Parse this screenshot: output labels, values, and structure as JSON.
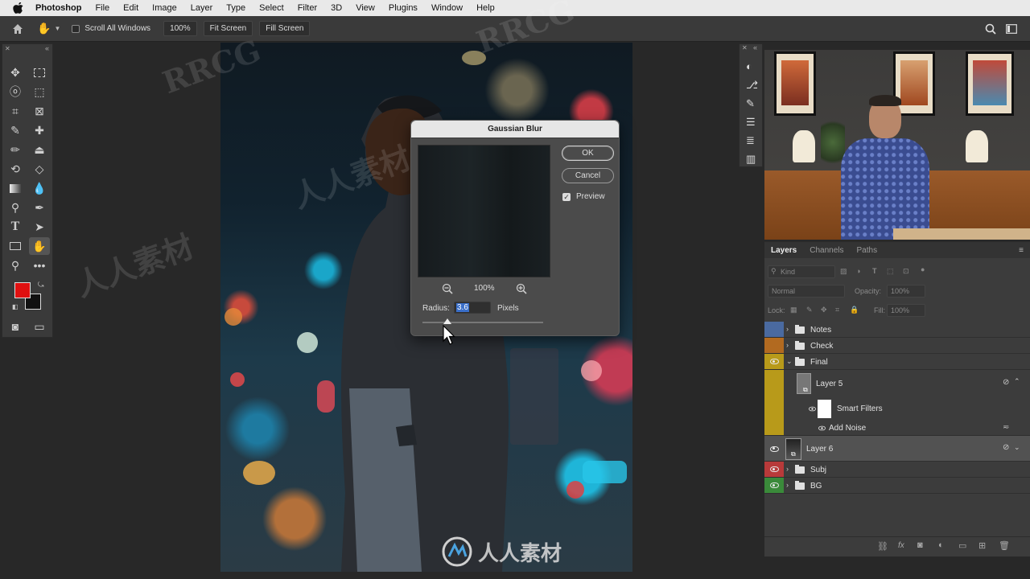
{
  "menubar": {
    "app": "Photoshop",
    "items": [
      "File",
      "Edit",
      "Image",
      "Layer",
      "Type",
      "Select",
      "Filter",
      "3D",
      "View",
      "Plugins",
      "Window",
      "Help"
    ]
  },
  "options": {
    "scroll_all_windows": "Scroll All Windows",
    "zoom": "100%",
    "fit_screen": "Fit Screen",
    "fill_screen": "Fill Screen"
  },
  "colors": {
    "foreground": "#e01010",
    "background": "#111111"
  },
  "dialog": {
    "title": "Gaussian Blur",
    "ok": "OK",
    "cancel": "Cancel",
    "preview_label": "Preview",
    "zoom": "100%",
    "radius_label": "Radius:",
    "radius_value": "3.6",
    "radius_unit": "Pixels"
  },
  "layers_panel": {
    "tabs": [
      "Layers",
      "Channels",
      "Paths"
    ],
    "kind_placeholder": "Kind",
    "blend_mode": "Normal",
    "opacity_label": "Opacity:",
    "opacity_value": "100%",
    "lock_label": "Lock:",
    "fill_label": "Fill:",
    "fill_value": "100%",
    "layers": [
      {
        "name": "Notes",
        "color": "#4a6aa0",
        "type": "group"
      },
      {
        "name": "Check",
        "color": "#b26a20",
        "type": "group"
      },
      {
        "name": "Final",
        "color": "#b89a1a",
        "type": "group-open"
      },
      {
        "name": "Layer 5",
        "color": "#b89a1a",
        "type": "smart"
      },
      {
        "name": "Smart Filters",
        "color": "#b89a1a",
        "type": "filters"
      },
      {
        "name": "Add Noise",
        "color": "#b89a1a",
        "type": "filter"
      },
      {
        "name": "Layer 6",
        "color": "",
        "type": "smart"
      },
      {
        "name": "Subj",
        "color": "#b83a3a",
        "type": "group"
      },
      {
        "name": "BG",
        "color": "#3a8a3a",
        "type": "group"
      }
    ]
  },
  "watermarks": [
    "RRCG",
    "人人素材",
    "RRCG",
    "人人素材"
  ],
  "logo_text": "人人素材"
}
